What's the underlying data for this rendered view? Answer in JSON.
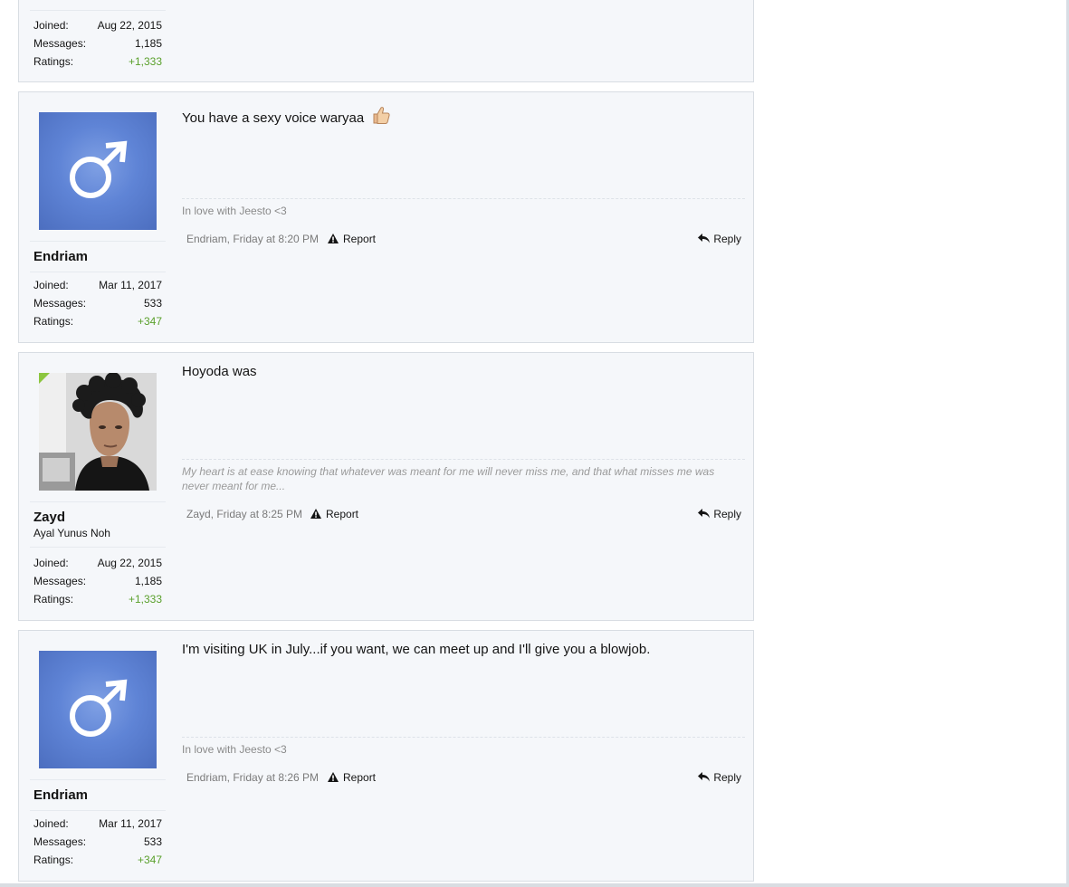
{
  "posts": [
    {
      "partial": true,
      "user": {
        "stats": [
          {
            "label": "Joined:",
            "value": "Aug 22, 2015"
          },
          {
            "label": "Messages:",
            "value": "1,185"
          },
          {
            "label": "Ratings:",
            "value": "+1,333"
          }
        ]
      }
    },
    {
      "user": {
        "name": "Endriam",
        "avatar": "default-male-avatar",
        "stats": [
          {
            "label": "Joined:",
            "value": "Mar 11, 2017"
          },
          {
            "label": "Messages:",
            "value": "533"
          },
          {
            "label": "Ratings:",
            "value": "+347"
          }
        ]
      },
      "message": "You have a sexy voice waryaa",
      "message_emoji": "thumbs-up-icon",
      "signature": "In love with Jeesto <3",
      "meta": "Endriam, Friday at 8:20 PM",
      "report_label": "Report",
      "reply_label": "Reply"
    },
    {
      "user": {
        "name": "Zayd",
        "title": "Ayal Yunus Noh",
        "avatar": "profile-photo",
        "online": true,
        "stats": [
          {
            "label": "Joined:",
            "value": "Aug 22, 2015"
          },
          {
            "label": "Messages:",
            "value": "1,185"
          },
          {
            "label": "Ratings:",
            "value": "+1,333"
          }
        ]
      },
      "message": "Hoyoda was",
      "signature": "My heart is at ease knowing that whatever was meant for me will never miss me, and that what misses me was never meant for me...",
      "meta": "Zayd, Friday at 8:25 PM",
      "report_label": "Report",
      "reply_label": "Reply"
    },
    {
      "user": {
        "name": "Endriam",
        "avatar": "default-male-avatar",
        "stats": [
          {
            "label": "Joined:",
            "value": "Mar 11, 2017"
          },
          {
            "label": "Messages:",
            "value": "533"
          },
          {
            "label": "Ratings:",
            "value": "+347"
          }
        ]
      },
      "message": "I'm visiting UK in July...if you want, we can meet up and I'll give you a blowjob.",
      "signature": "In love with Jeesto <3",
      "meta": "Endriam, Friday at 8:26 PM",
      "report_label": "Report",
      "reply_label": "Reply"
    }
  ],
  "colors": {
    "positive_rating": "#5aa02c",
    "post_background": "#f5f7fa",
    "avatar_blue": "#5f84d6",
    "online_indicator": "#8cc63f"
  }
}
